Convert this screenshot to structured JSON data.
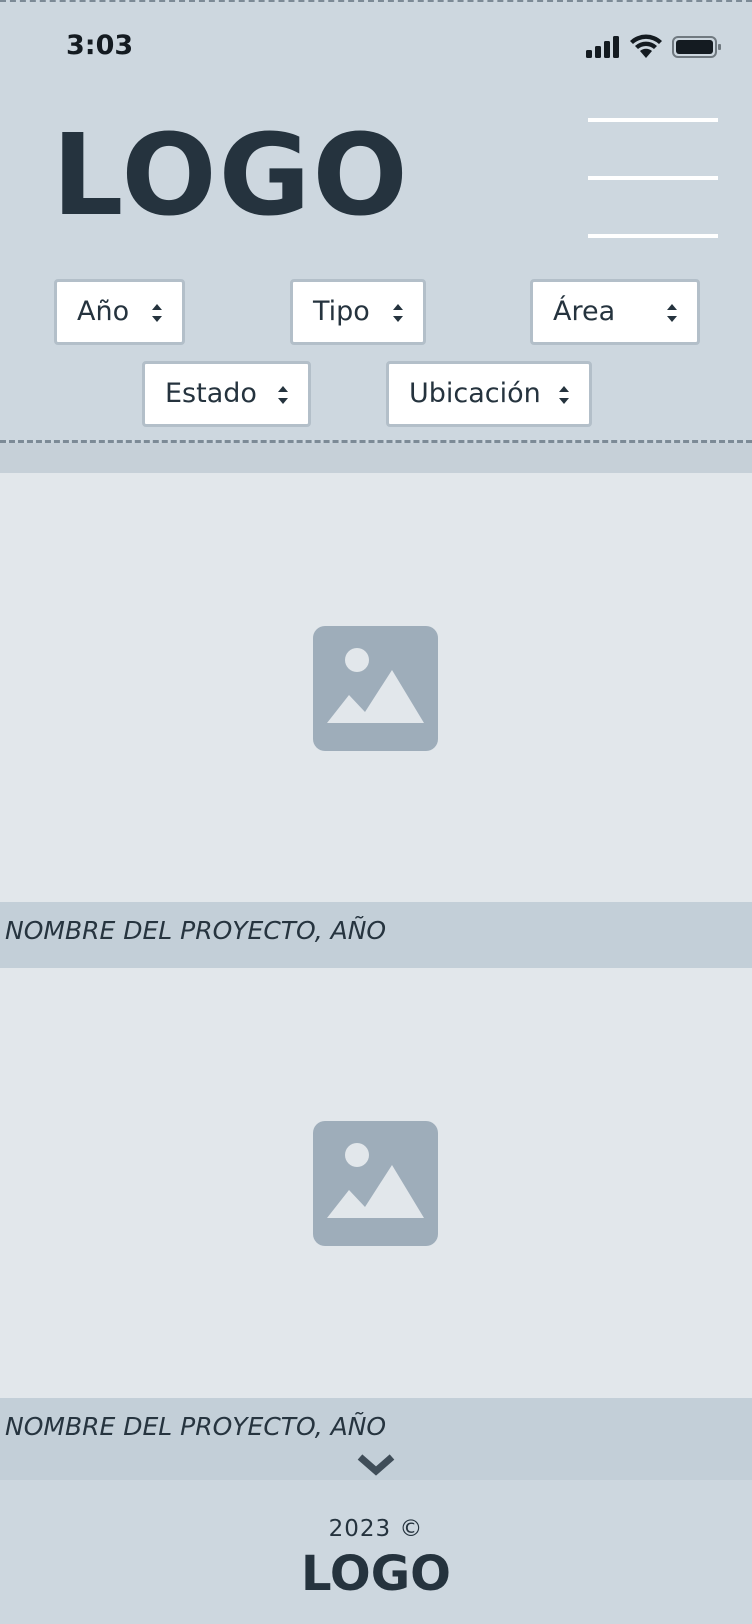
{
  "status_bar": {
    "time": "3:03",
    "icons": [
      "signal-icon",
      "wifi-icon",
      "battery-icon"
    ]
  },
  "header": {
    "logo": "LOGO",
    "menu_icon": "hamburger-menu-icon"
  },
  "filters": [
    {
      "label": "Año"
    },
    {
      "label": "Tipo"
    },
    {
      "label": "Área"
    },
    {
      "label": "Estado"
    },
    {
      "label": "Ubicación"
    }
  ],
  "projects": [
    {
      "caption": "NOMBRE DEL PROYECTO, AÑO",
      "image_icon": "image-placeholder-icon"
    },
    {
      "caption": "NOMBRE DEL PROYECTO, AÑO",
      "image_icon": "image-placeholder-icon"
    }
  ],
  "scroll_indicator": {
    "icon": "chevron-down-icon"
  },
  "footer": {
    "copyright": "2023 ©",
    "logo": "LOGO"
  },
  "colors": {
    "header_bg": "#cdd7df",
    "logo": "#25333e",
    "image_bg": "#e2e7eb",
    "caption_bg": "#c3cfd8",
    "placeholder_icon": "#9eadba"
  }
}
